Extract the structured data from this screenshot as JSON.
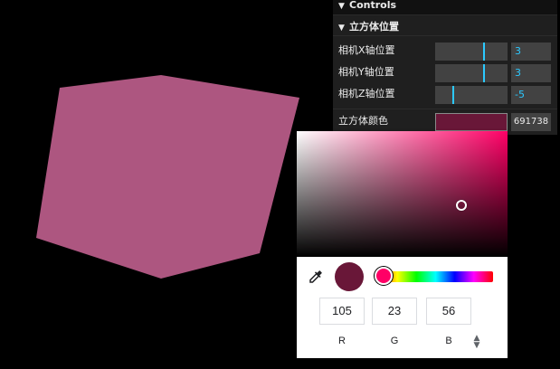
{
  "gui": {
    "title": "Controls",
    "folder": {
      "title": "立方体位置",
      "controls": [
        {
          "label": "相机X轴位置",
          "value": "3",
          "slider_fraction": 0.66
        },
        {
          "label": "相机Y轴位置",
          "value": "3",
          "slider_fraction": 0.66
        },
        {
          "label": "相机Z轴位置",
          "value": "-5",
          "slider_fraction": 0.24
        }
      ]
    },
    "color_control": {
      "label": "立方体颜色",
      "value": "691738",
      "swatch_color": "#691738"
    }
  },
  "cube": {
    "color": "#ad5680"
  },
  "picker": {
    "current_color": "#691738",
    "hue_color": "#ff0066",
    "saturation": 0.78,
    "brightness": 0.41,
    "hue_fraction": 0.04,
    "channels": [
      {
        "label": "R",
        "value": "105"
      },
      {
        "label": "G",
        "value": "23"
      },
      {
        "label": "B",
        "value": "56"
      }
    ],
    "format_toggle_icon": "up-down-arrows-icon",
    "eyedropper_icon": "eyedropper-icon"
  }
}
